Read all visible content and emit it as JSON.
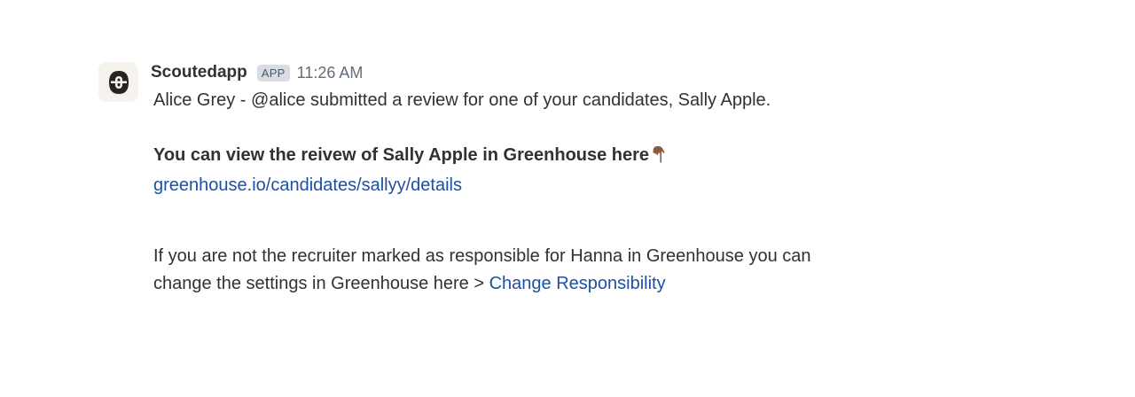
{
  "message": {
    "sender": "Scoutedapp",
    "badge": "APP",
    "timestamp": "11:26 AM",
    "line1": "Alice Grey - @alice submitted a review for one of your candidates, Sally Apple.",
    "bold_line": "You can view the reivew of Sally Apple in Greenhouse here",
    "bold_line_emoji": "pointing-down-hand-icon",
    "link1": "greenhouse.io/candidates/sallyy/details",
    "para2_line1": "If you are not the recruiter marked as responsible for Hanna in Greenhouse you can",
    "para2_line2": "change the settings in Greenhouse here > ",
    "link2": "Change Responsibility"
  },
  "colors": {
    "link": "#1d4fa6",
    "text": "#2f3133",
    "badge_bg": "#d8dde3",
    "timestamp": "#616d78",
    "avatar_bg": "#f6f3ef",
    "avatar_mark": "#2b2320"
  }
}
